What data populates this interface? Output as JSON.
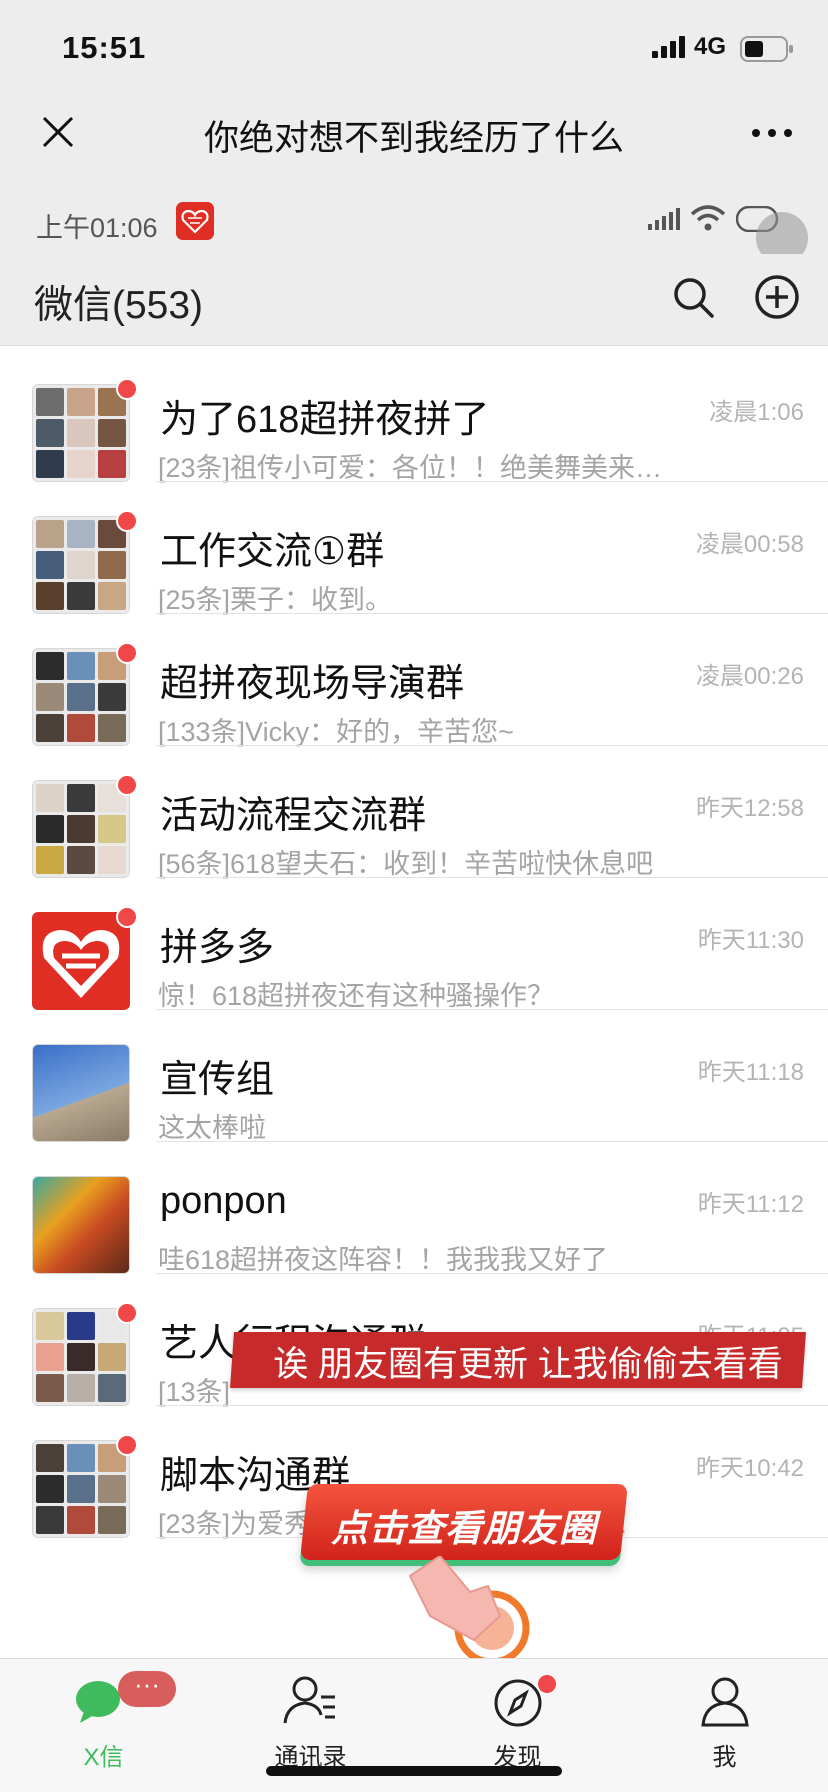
{
  "outer_status": {
    "time": "15:51",
    "network": "4G"
  },
  "web_header": {
    "title": "你绝对想不到我经历了什么"
  },
  "inner_status": {
    "time": "上午01:06"
  },
  "app_header": {
    "title": "微信(553)"
  },
  "chats": [
    {
      "name": "为了618超拼夜拼了",
      "time": "凌晨1:06",
      "preview": "[23条]祖传小可爱：各位！！绝美舞美来了…",
      "unread_dot": true,
      "avatar_colors": [
        "#6d6d6d",
        "#c7a48a",
        "#9a7450",
        "#4d5a68",
        "#d9c6bc",
        "#765543",
        "#2f3c4d",
        "#e7d5cc",
        "#b84040"
      ]
    },
    {
      "name": "工作交流①群",
      "time": "凌晨00:58",
      "preview": "[25条]栗子：收到。",
      "unread_dot": true,
      "avatar_colors": [
        "#b9a18a",
        "#a8b4c4",
        "#6a4a3a",
        "#455c7a",
        "#dfd5ce",
        "#8f6b4c",
        "#5a3e2c",
        "#3a3a3a",
        "#c8a882"
      ]
    },
    {
      "name": "超拼夜现场导演群",
      "time": "凌晨00:26",
      "preview": "[133条]Vicky：好的，辛苦您~",
      "unread_dot": true,
      "avatar_colors": [
        "#2c2c2c",
        "#6a8fb8",
        "#c79e7a",
        "#9c8a78",
        "#58708a",
        "#3a3a3a",
        "#4a4038",
        "#b04a3a",
        "#7a6a5a"
      ]
    },
    {
      "name": "活动流程交流群",
      "time": "昨天12:58",
      "preview": "[56条]618望夫石：收到！辛苦啦快休息吧",
      "unread_dot": true,
      "avatar_colors": [
        "#dcd2c8",
        "#3a3a3a",
        "#e8e0d8",
        "#2a2a2a",
        "#4a3a30",
        "#d8c888",
        "#c8a840",
        "#5a4a40",
        "#e8d8d0"
      ]
    },
    {
      "name": "拼多多",
      "time": "昨天11:30",
      "preview": "惊！618超拼夜还有这种骚操作？",
      "unread_dot": true,
      "avatar_type": "pdd"
    },
    {
      "name": "宣传组",
      "time": "昨天11:18",
      "preview": "这太棒啦",
      "unread_dot": false,
      "avatar_type": "sky"
    },
    {
      "name": "ponpon",
      "time": "昨天11:12",
      "preview": "哇618超拼夜这阵容！！我我我又好了",
      "unread_dot": false,
      "avatar_type": "art"
    },
    {
      "name": "艺人行程沟通群",
      "time": "昨天11:05",
      "preview": "[13条]",
      "unread_dot": true,
      "avatar_colors": [
        "#d8c89a",
        "#2a3a8a",
        "#e8e8e8",
        "#e8a090",
        "#3a2a2a",
        "#c8a878",
        "#7a5a4a",
        "#b8b0a8",
        "#5a6a7a"
      ]
    },
    {
      "name": "脚本沟通群",
      "time": "昨天10:42",
      "preview": "[23条]为爱秀",
      "preview_suffix": "来了…",
      "unread_dot": true,
      "avatar_colors": [
        "#4a4038",
        "#6a8fb8",
        "#c79e7a",
        "#2c2c2c",
        "#58708a",
        "#9c8a78",
        "#3a3a3a",
        "#b04a3a",
        "#7a6a5a"
      ]
    }
  ],
  "overlays": {
    "banner_text": "诶 朋友圈有更新 让我偷偷去看看",
    "cta_text": "点击查看朋友圈"
  },
  "tabs": [
    {
      "label": "X信",
      "icon": "chat-bubbles-icon",
      "active": true,
      "badge": "···"
    },
    {
      "label": "通讯录",
      "icon": "contacts-icon",
      "active": false
    },
    {
      "label": "发现",
      "icon": "compass-icon",
      "active": false,
      "dot": true
    },
    {
      "label": "我",
      "icon": "person-icon",
      "active": false
    }
  ],
  "colors": {
    "accent_green": "#3dbb5d",
    "badge_red": "#f04848",
    "banner_red": "#c62a2a"
  }
}
